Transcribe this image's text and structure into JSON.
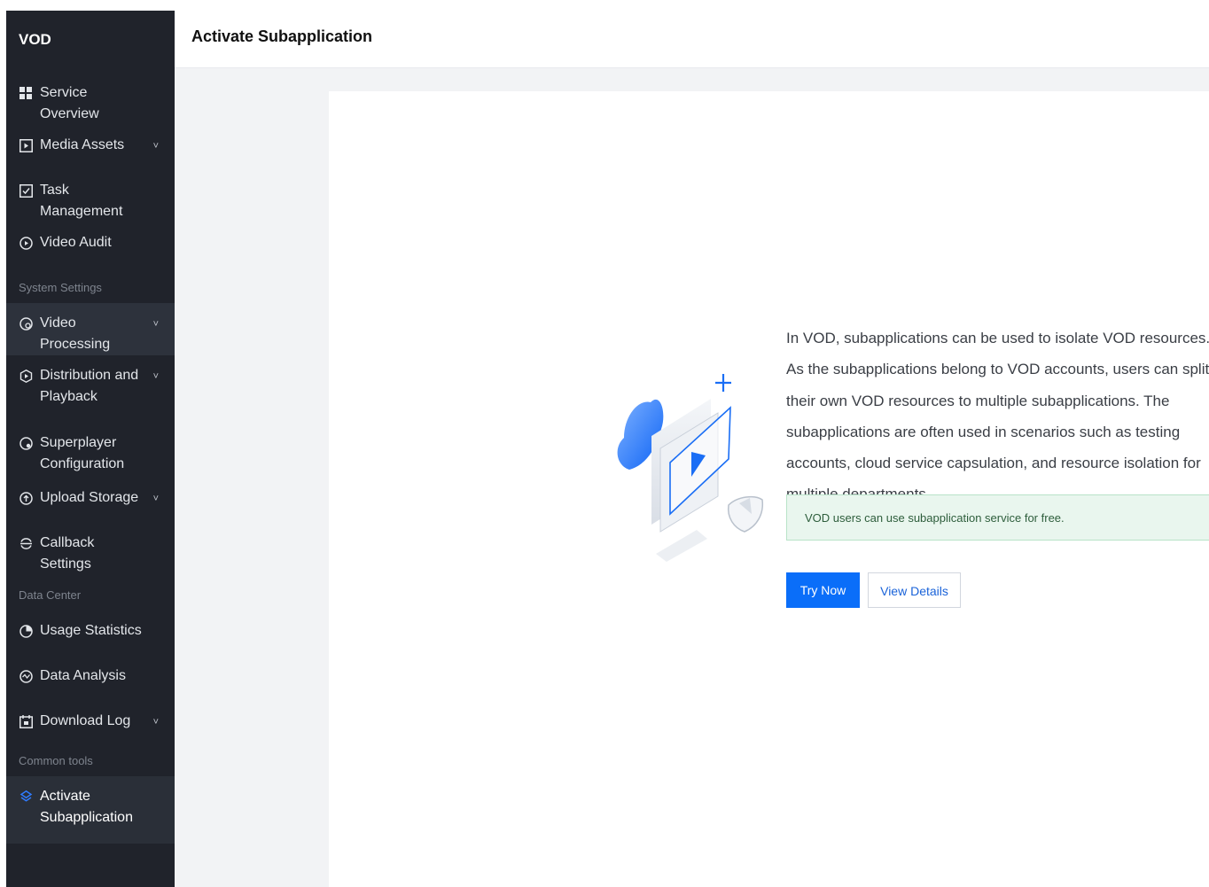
{
  "sidebar": {
    "brand": "VOD",
    "items_top": [
      {
        "label": "Service Overview",
        "icon": "grid-icon"
      },
      {
        "label": "Media Assets",
        "icon": "play-square-icon",
        "has_chevron": true
      },
      {
        "label": "Task Management",
        "icon": "checkbox-icon"
      },
      {
        "label": "Video Audit",
        "icon": "audit-icon"
      }
    ],
    "section_system": "System Settings",
    "items_system": [
      {
        "label": "Video Processing",
        "icon": "processing-icon",
        "has_chevron": true
      },
      {
        "label": "Distribution and Playback",
        "icon": "distribution-icon",
        "has_chevron": true
      },
      {
        "label": "Superplayer Configuration",
        "icon": "player-icon"
      },
      {
        "label": "Upload Storage",
        "icon": "upload-icon",
        "has_chevron": true
      },
      {
        "label": "Callback Settings",
        "icon": "callback-icon"
      }
    ],
    "section_data": "Data Center",
    "items_data": [
      {
        "label": "Usage Statistics",
        "icon": "pie-icon"
      },
      {
        "label": "Data Analysis",
        "icon": "analysis-icon"
      },
      {
        "label": "Download Log",
        "icon": "calendar-icon",
        "has_chevron": true
      }
    ],
    "section_tools": "Common tools",
    "items_tools": [
      {
        "label": "Activate Subapplication",
        "icon": "layers-icon",
        "active": true
      }
    ],
    "chevron": "˅"
  },
  "header": {
    "title": "Activate Subapplication"
  },
  "main": {
    "description": "In VOD, subapplications can be used to isolate VOD resources. As the subapplications belong to VOD accounts, users can split their own VOD resources to multiple subapplications. The subapplications are often used in scenarios such as testing accounts, cloud service capsulation, and resource isolation for multiple departments.",
    "notice": "VOD users can use subapplication service for free.",
    "try_now_label": "Try Now",
    "view_details_label": "View Details"
  },
  "colors": {
    "sidebar_bg": "#20232b",
    "primary": "#0a6ef9",
    "notice_bg": "#e9f6ee",
    "accent_icon": "#2f7bff"
  }
}
